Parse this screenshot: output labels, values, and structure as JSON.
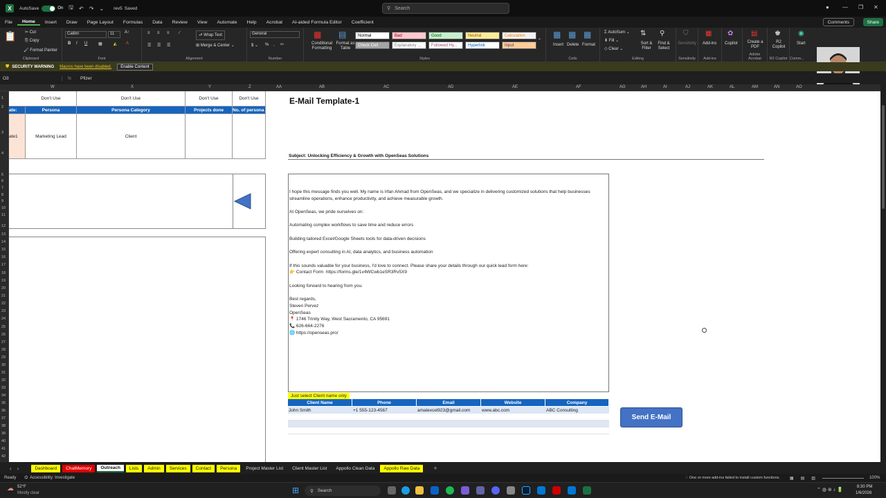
{
  "titlebar": {
    "autosave_label": "AutoSave",
    "autosave_state": "On",
    "filename": "rev5",
    "saved": "Saved",
    "search_placeholder": "Search"
  },
  "menu": [
    "File",
    "Home",
    "Insert",
    "Draw",
    "Page Layout",
    "Formulas",
    "Data",
    "Review",
    "View",
    "Automate",
    "Help",
    "Acrobat",
    "AI-aided Formula Editor",
    "Coefficient"
  ],
  "menu_active": "Home",
  "actions": {
    "comments": "Comments",
    "share": "Share"
  },
  "ribbon": {
    "clipboard": {
      "cut": "Cut",
      "copy": "Copy",
      "painter": "Format Painter",
      "label": "Clipboard"
    },
    "font": {
      "name": "Calibri",
      "size": "11",
      "label": "Font"
    },
    "alignment": {
      "wrap": "Wrap Text",
      "merge": "Merge & Center",
      "label": "Alignment"
    },
    "number": {
      "format": "General",
      "label": "Number"
    },
    "styles": {
      "conditional": "Conditional Formatting",
      "format_table": "Format as Table",
      "cells": [
        {
          "name": "Normal",
          "bg": "#ffffff",
          "fg": "#000000"
        },
        {
          "name": "Bad",
          "bg": "#ffc7ce",
          "fg": "#9c0006"
        },
        {
          "name": "Good",
          "bg": "#c6efce",
          "fg": "#006100"
        },
        {
          "name": "Neutral",
          "bg": "#ffeb9c",
          "fg": "#9c5700"
        },
        {
          "name": "Calculation",
          "bg": "#f2f2f2",
          "fg": "#fa7d00"
        },
        {
          "name": "Check Cell",
          "bg": "#a5a5a5",
          "fg": "#ffffff"
        },
        {
          "name": "Explanatory ...",
          "bg": "#ffffff",
          "fg": "#7f7f7f"
        },
        {
          "name": "Followed Hy...",
          "bg": "#ffffff",
          "fg": "#954f72"
        },
        {
          "name": "Hyperlink",
          "bg": "#ffffff",
          "fg": "#0563c1"
        },
        {
          "name": "Input",
          "bg": "#ffcc99",
          "fg": "#3f3f76"
        }
      ],
      "label": "Styles"
    },
    "cells": {
      "insert": "Insert",
      "delete": "Delete",
      "format": "Format",
      "label": "Cells"
    },
    "editing": {
      "autosum": "AutoSum",
      "fill": "Fill",
      "clear": "Clear",
      "sort": "Sort & Filter",
      "find": "Find & Select",
      "label": "Editing"
    },
    "sensitivity": {
      "name": "Sensitivity",
      "label": "Sensitivity"
    },
    "addins": {
      "name": "Add-ins",
      "label": "Add-ins"
    },
    "copilot": "Copilot",
    "pdf": {
      "name": "Create a PDF",
      "label": "Adobe Acrobat"
    },
    "r2": {
      "name": "R2 Copilot",
      "label": "R2 Copilot"
    },
    "start": "Start",
    "comm_label": "Comm..."
  },
  "security": {
    "title": "SECURITY WARNING",
    "message": "Macros have been disabled.",
    "button": "Enable Content"
  },
  "formula": {
    "cell": "O3",
    "value": "Pfizer"
  },
  "columns": [
    "W",
    "X",
    "Y",
    "Z",
    "AA",
    "AB",
    "AC",
    "AD",
    "AE",
    "AF",
    "AG",
    "AH",
    "AI",
    "AJ",
    "AK",
    "AL",
    "AM",
    "AN",
    "AO"
  ],
  "rows": [
    "1",
    "2",
    "3",
    "4",
    "5",
    "6",
    "7",
    "8",
    "9",
    "10",
    "11",
    "12",
    "13",
    "14",
    "15",
    "16",
    "17",
    "18",
    "19",
    "20",
    "21",
    "22",
    "23",
    "24",
    "25",
    "26",
    "27",
    "28",
    "29",
    "30",
    "31",
    "32",
    "33",
    "34",
    "35",
    "36",
    "37",
    "38",
    "39",
    "40",
    "41",
    "42"
  ],
  "left_table": {
    "dont_use": [
      "Don't Use",
      "Don't Use",
      "Don't Use",
      "Don't Use"
    ],
    "headers": [
      "ate:",
      "Persona",
      "Persona Category",
      "Projects done",
      "No. of persona"
    ],
    "row": [
      "ate1",
      "Marketing Lead",
      "Client",
      "",
      ""
    ]
  },
  "email": {
    "title": "E-Mail Template-1",
    "subject": "Subject: Unlocking Efficiency & Growth with OpenSeas Solutions",
    "lines": [
      "I hope this message finds you well. My name is Irfan Ahmad from OpenSeas, and we specialize in delivering customized solutions that help businesses",
      "streamline operations, enhance productivity, and achieve measurable growth.",
      "",
      "At OpenSeas, we pride ourselves on:",
      "",
      "Automating complex workflows to save time and reduce errors",
      "",
      "Building tailored Excel/Google Sheets tools for data-driven decisions",
      "",
      "Offering expert consulting in AI, data analytics, and business automation",
      "",
      "If this sounds valuable for your business, I'd love to connect. Please share your details through our quick lead form here:",
      "👉 Contact Form  https://forms.gle/1v4WCwb1eSR3Rv5X9",
      "",
      "Looking forward to hearing from you.",
      "",
      "Best regards,",
      "Steven Pervez",
      "OpenSeas",
      "📍 1746 Trinity Way, West Sacramento, CA 95691",
      "📞 626-664-2276",
      "🌐 https://openseas.pro/"
    ]
  },
  "client_hint": "Just select Client name only",
  "client_table": {
    "headers": [
      "Client Name",
      "Phone",
      "Email",
      "Website",
      "Company"
    ],
    "rows": [
      [
        "John Smith",
        "+1 555-123-4567",
        "amalexcel923@gmail.com",
        "www.abc.com",
        "ABC Consulting"
      ]
    ]
  },
  "send_button": "Send E-Mail",
  "sheet_tabs": [
    {
      "name": "Dashboard",
      "style": "yellow"
    },
    {
      "name": "ChatMemory",
      "style": "red"
    },
    {
      "name": "Outreach",
      "style": "active"
    },
    {
      "name": "Lists",
      "style": "yellow"
    },
    {
      "name": "Admin",
      "style": "yellow"
    },
    {
      "name": "Services",
      "style": "yellow"
    },
    {
      "name": "Contact",
      "style": "yellow"
    },
    {
      "name": "Persona",
      "style": "yellow"
    },
    {
      "name": "Project Master List",
      "style": "plain"
    },
    {
      "name": "Client Master List",
      "style": "plain"
    },
    {
      "name": "Appollo Clean Data",
      "style": "plain"
    },
    {
      "name": "Appollo Raw Data",
      "style": "yellow"
    }
  ],
  "status": {
    "ready": "Ready",
    "accessibility": "Accessibility: Investigate",
    "addin_msg": "One or more add-ins failed to install custom functions.",
    "zoom": "100%"
  },
  "taskbar": {
    "temp": "52°F",
    "weather": "Mostly clear",
    "search": "Search",
    "time": "8:30 PM",
    "date": "1/6/2026"
  }
}
